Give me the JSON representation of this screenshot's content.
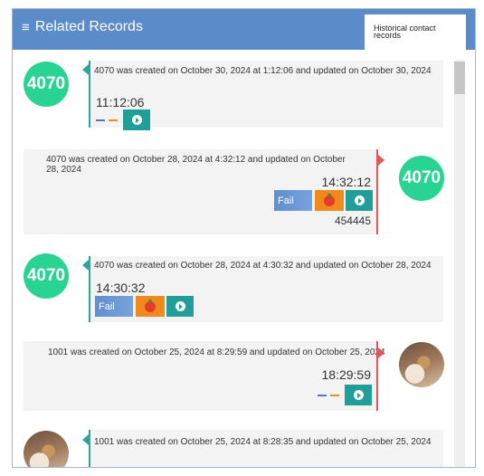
{
  "header": {
    "menu_icon": "hamburger-menu-icon",
    "title": "Related Records",
    "tab_label": "Historical contact records"
  },
  "records": [
    {
      "avatar_text": "4070",
      "description": "4070 was created on October 30, 2024 at 1:12:06 and updated on October 30, 2024",
      "time": "11:12:06"
    },
    {
      "avatar_text": "4070",
      "description_line1": "4070 was created on October 28, 2024 at 4:32:12 and updated on October",
      "description_line2": "28, 2024",
      "time": "14:32:12",
      "fail_label": "Fail",
      "number": "454445"
    },
    {
      "avatar_text": "4070",
      "description": "4070 was created on October 28, 2024 at 4:30:32 and updated on October 28, 2024",
      "time": "14:30:32",
      "fail_label": "Fail"
    },
    {
      "avatar": "user-photo",
      "description": "1001 was created on October 25, 2024 at 8:29:59 and updated on October 25, 2024",
      "time": "18:29:59"
    },
    {
      "avatar": "user-photo",
      "description": "1001 was created on October 25, 2024 at 8:28:35 and updated on October 25, 2024"
    }
  ],
  "colors": {
    "header": "#5b8cc9",
    "avatar_green": "#29d493",
    "teal": "#219e98",
    "red_timeline": "#e0565f",
    "orange": "#f08a1d",
    "fail_blue": "#5f8fd0"
  }
}
